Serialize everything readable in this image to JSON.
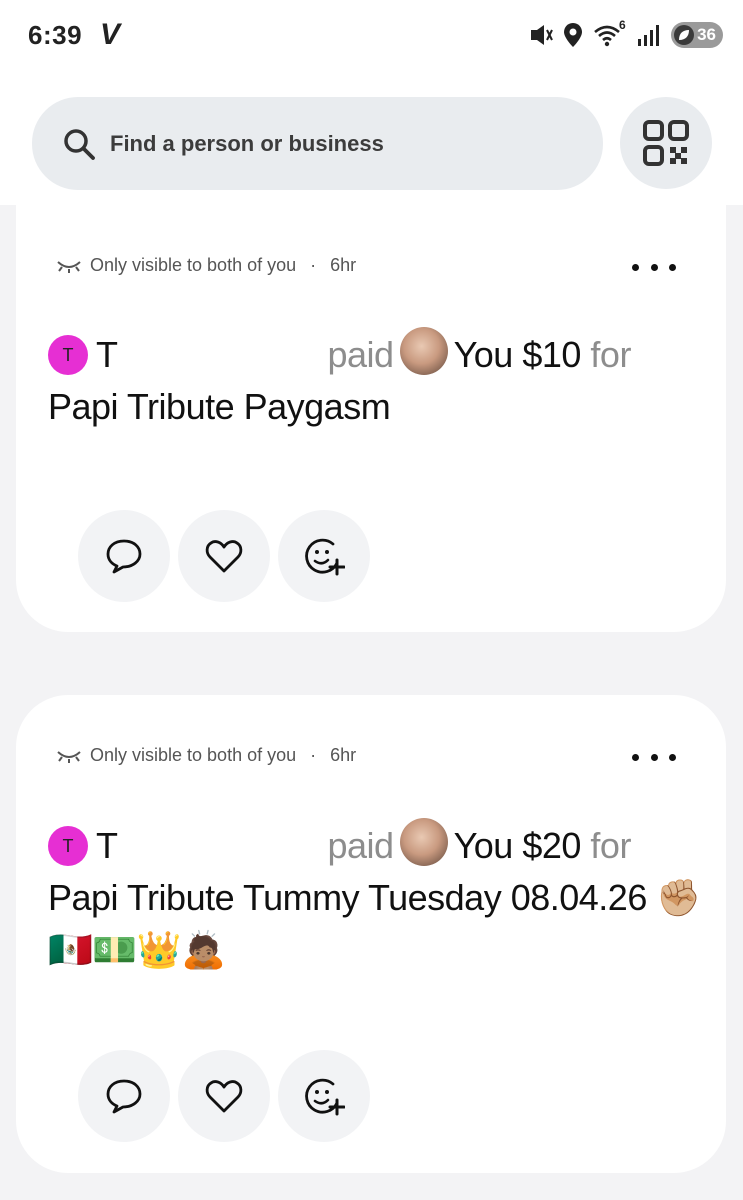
{
  "status_bar": {
    "time": "6:39",
    "app_logo": "V",
    "wifi_label": "6",
    "battery": "36",
    "icons": [
      "mute-vibrate-icon",
      "location-icon",
      "wifi-icon",
      "signal-icon",
      "battery-icon"
    ]
  },
  "search": {
    "placeholder": "Find a person or business",
    "icon": "search-icon"
  },
  "qr_button": {
    "icon": "qr-code-icon"
  },
  "feed": [
    {
      "visibility_text": "Only visible to both of you",
      "separator": "·",
      "time_ago": "6hr",
      "payer_initial": "T",
      "payer_name": "T",
      "verb": "paid",
      "payee": "You",
      "amount": "$10",
      "for_word": "for",
      "note": "Papi Tribute Paygasm",
      "actions": [
        "comment-icon",
        "like-icon",
        "add-reaction-icon"
      ]
    },
    {
      "visibility_text": "Only visible to both of you",
      "separator": "·",
      "time_ago": "6hr",
      "payer_initial": "T",
      "payer_name": "T",
      "verb": "paid",
      "payee": "You",
      "amount": "$20",
      "for_word": "for",
      "note": "Papi Tribute Tummy Tuesday 08.04.26 ✊🏼🇲🇽💵👑🙇🏽",
      "actions": [
        "comment-icon",
        "like-icon",
        "add-reaction-icon"
      ]
    }
  ],
  "colors": {
    "page_bg": "#f3f3f5",
    "card_bg": "#ffffff",
    "avatar_pink": "#e62fd3",
    "muted_text": "#8d8d8d",
    "pill_bg": "#e9ecef"
  }
}
